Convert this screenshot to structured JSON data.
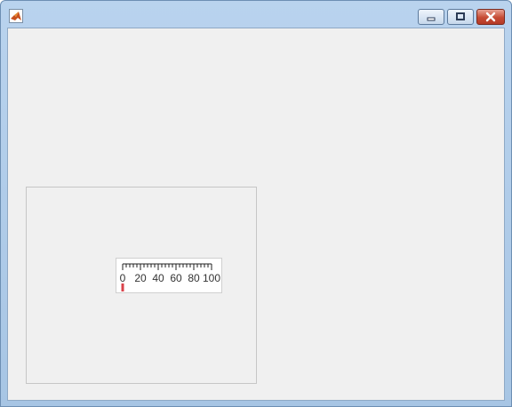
{
  "window": {
    "title": "",
    "app_icon": "matlab-logo-icon",
    "controls": {
      "minimize_icon": "minimize-icon",
      "maximize_icon": "maximize-icon",
      "close_icon": "close-icon"
    }
  },
  "gauge": {
    "type": "linear-gauge",
    "min": 0,
    "max": 100,
    "value": 0,
    "major_tick_labels": [
      "0",
      "20",
      "40",
      "60",
      "80",
      "100"
    ],
    "major_tick_values": [
      0,
      20,
      40,
      60,
      80,
      100
    ],
    "minor_ticks_per_major": 4,
    "needle_color": "#d9434b"
  },
  "colors": {
    "client_background": "#f0f0f0",
    "panel_border": "#c6c6c6",
    "close_button": "#c64b34"
  }
}
